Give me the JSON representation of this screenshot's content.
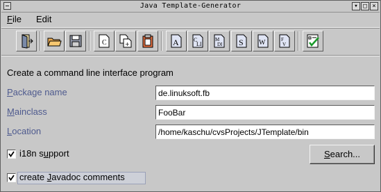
{
  "window": {
    "title": "Java Template-Generator"
  },
  "menu": {
    "file": {
      "mnemonic": "F",
      "rest": "ile"
    },
    "edit": {
      "label": "Edit"
    }
  },
  "toolbar": {
    "buttons": [
      {
        "icon": "exit-door-icon"
      },
      {
        "icon": "open-folder-icon"
      },
      {
        "icon": "save-floppy-icon"
      },
      {
        "icon": "new-class-icon"
      },
      {
        "icon": "add-file-icon"
      },
      {
        "icon": "clipboard-icon"
      },
      {
        "icon": "template-a-icon"
      },
      {
        "icon": "template-cli-icon"
      },
      {
        "icon": "template-mdi-icon"
      },
      {
        "icon": "template-s-icon"
      },
      {
        "icon": "template-w-icon"
      },
      {
        "icon": "template-fv-icon"
      },
      {
        "icon": "checklist-icon"
      }
    ]
  },
  "form": {
    "heading": "Create a command line interface program",
    "package": {
      "mnemonic": "P",
      "rest": "ackage name",
      "value": "de.linuksoft.fb"
    },
    "mainclass": {
      "mnemonic": "M",
      "rest": "ainclass",
      "value": "FooBar"
    },
    "location": {
      "mnemonic": "L",
      "rest": "ocation",
      "value": "/home/kaschu/cvsProjects/JTemplate/bin"
    },
    "i18n": {
      "pre": "i18n s",
      "mnemonic": "u",
      "rest": "pport",
      "checked": true
    },
    "javadoc": {
      "pre": "create ",
      "mnemonic": "J",
      "rest": "avadoc comments",
      "checked": true
    },
    "search": {
      "mnemonic": "S",
      "rest": "earch..."
    }
  },
  "colors": {
    "background": "#c8c8c8",
    "label": "#4e5a8e",
    "field": "#ffffff"
  }
}
